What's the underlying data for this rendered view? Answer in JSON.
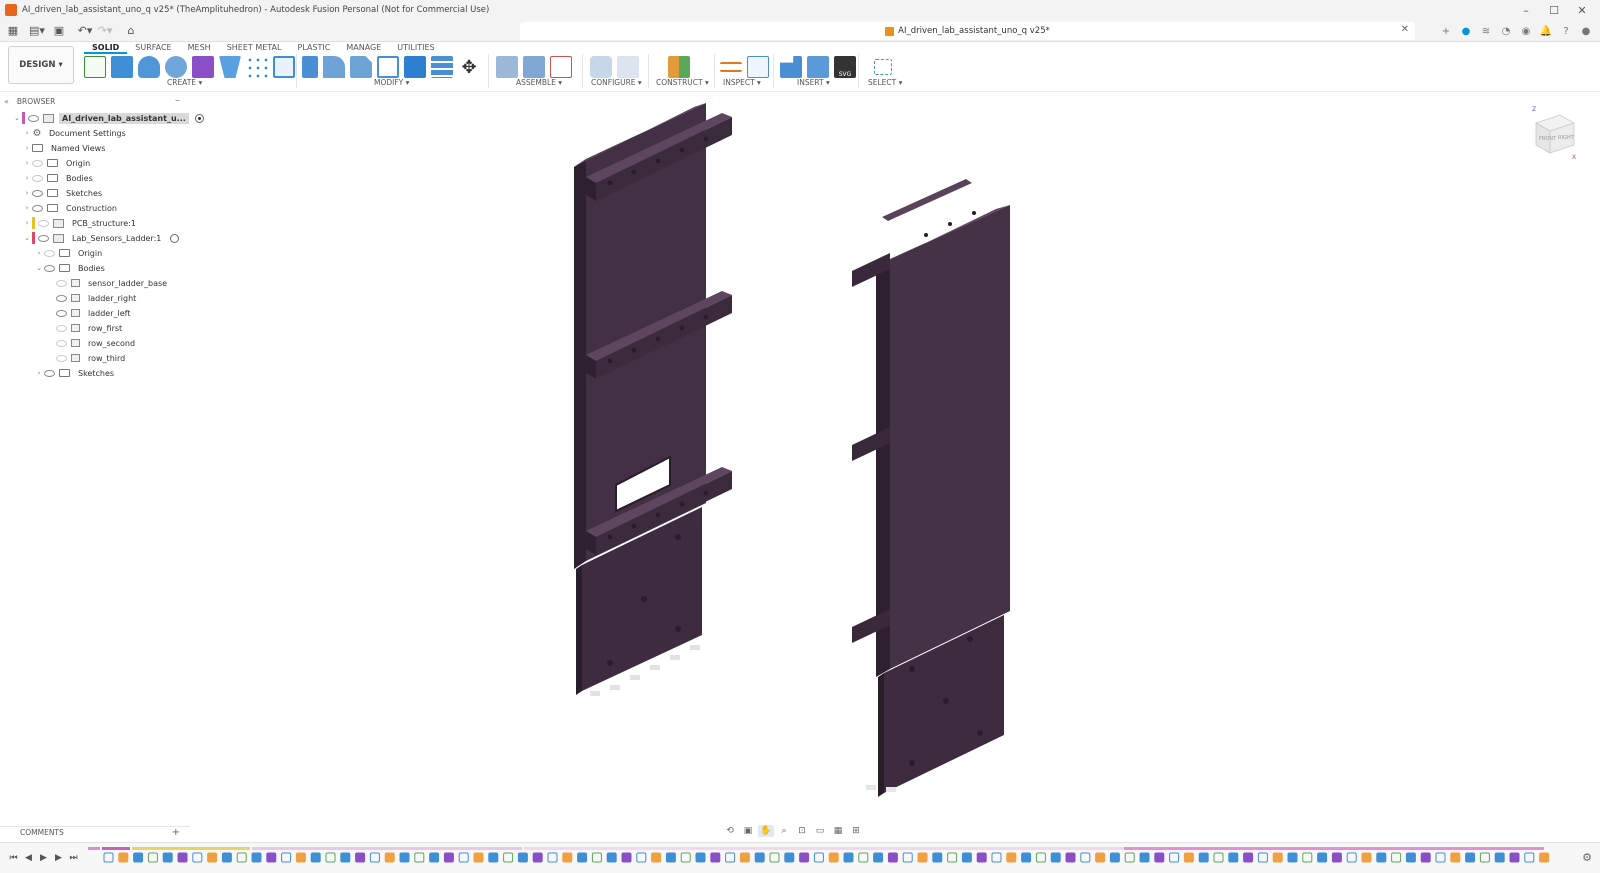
{
  "window": {
    "title": "AI_driven_lab_assistant_uno_q v25* (TheAmplituhedron) - Autodesk Fusion Personal (Not for Commercial Use)"
  },
  "document_tab": {
    "label": "AI_driven_lab_assistant_uno_q v25*"
  },
  "workspace": {
    "label": "DESIGN ▾"
  },
  "tabs": [
    "SOLID",
    "SURFACE",
    "MESH",
    "SHEET METAL",
    "PLASTIC",
    "MANAGE",
    "UTILITIES"
  ],
  "tool_groups": {
    "create": "CREATE ▾",
    "modify": "MODIFY ▾",
    "assemble": "ASSEMBLE ▾",
    "configure": "CONFIGURE ▾",
    "construct": "CONSTRUCT ▾",
    "inspect": "INSPECT ▾",
    "insert": "INSERT ▾",
    "select": "SELECT ▾"
  },
  "browser": {
    "header": "BROWSER",
    "items": [
      {
        "label": "AI_driven_lab_assistant_u...",
        "level": 0
      },
      {
        "label": "Document Settings",
        "level": 1
      },
      {
        "label": "Named Views",
        "level": 1
      },
      {
        "label": "Origin",
        "level": 1
      },
      {
        "label": "Bodies",
        "level": 1
      },
      {
        "label": "Sketches",
        "level": 1
      },
      {
        "label": "Construction",
        "level": 1
      },
      {
        "label": "PCB_structure:1",
        "level": 1
      },
      {
        "label": "Lab_Sensors_Ladder:1",
        "level": 1
      },
      {
        "label": "Origin",
        "level": 2
      },
      {
        "label": "Bodies",
        "level": 2
      },
      {
        "label": "sensor_ladder_base",
        "level": 3
      },
      {
        "label": "ladder_right",
        "level": 3
      },
      {
        "label": "ladder_left",
        "level": 3
      },
      {
        "label": "row_first",
        "level": 3
      },
      {
        "label": "row_second",
        "level": 3
      },
      {
        "label": "row_third",
        "level": 3
      },
      {
        "label": "Sketches",
        "level": 2
      }
    ]
  },
  "comments": {
    "label": "COMMENTS"
  },
  "colors": {
    "part": "#3f2b40",
    "accent": "#0696d7"
  }
}
